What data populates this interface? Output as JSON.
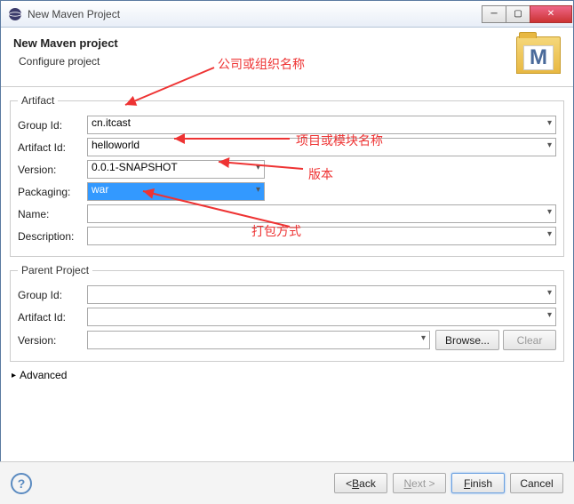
{
  "window": {
    "title": "New Maven Project"
  },
  "banner": {
    "title": "New Maven project",
    "subtitle": "Configure project",
    "icon_letter": "M"
  },
  "artifact": {
    "legend": "Artifact",
    "group_id_label": "Group Id:",
    "group_id_value": "cn.itcast",
    "artifact_id_label": "Artifact Id:",
    "artifact_id_value": "helloworld",
    "version_label": "Version:",
    "version_value": "0.0.1-SNAPSHOT",
    "packaging_label": "Packaging:",
    "packaging_value": "war",
    "name_label": "Name:",
    "name_value": "",
    "description_label": "Description:",
    "description_value": ""
  },
  "parent": {
    "legend": "Parent Project",
    "group_id_label": "Group Id:",
    "group_id_value": "",
    "artifact_id_label": "Artifact Id:",
    "artifact_id_value": "",
    "version_label": "Version:",
    "version_value": "",
    "browse_label": "Browse...",
    "clear_label": "Clear"
  },
  "advanced_label": "Advanced",
  "footer": {
    "back_label": "< Back",
    "next_label": "Next >",
    "finish_label": "Finish",
    "cancel_label": "Cancel"
  },
  "annotations": {
    "a1": "公司或组织名称",
    "a2": "项目或模块名称",
    "a3": "版本",
    "a4": "打包方式"
  }
}
